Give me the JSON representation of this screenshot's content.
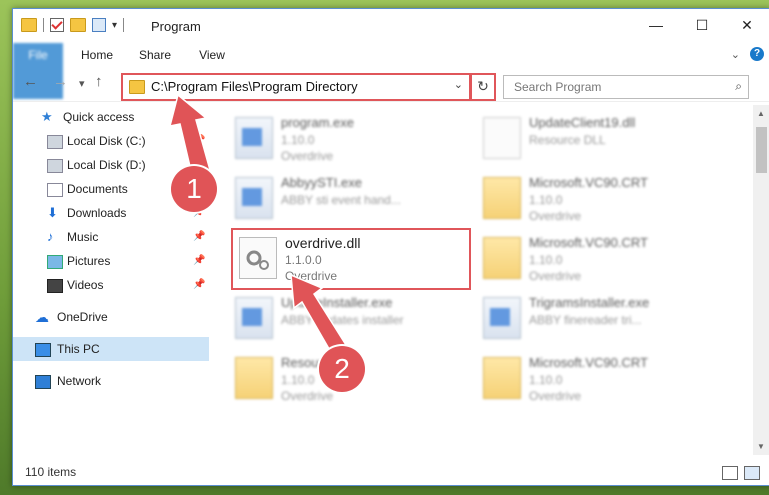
{
  "window": {
    "title": "Program",
    "controls": {
      "minimize": "—",
      "maximize": "☐",
      "close": "✕"
    }
  },
  "ribbon": {
    "tabs": [
      {
        "label": "File"
      },
      {
        "label": "Home"
      },
      {
        "label": "Share"
      },
      {
        "label": "View"
      }
    ]
  },
  "address": {
    "path": "C:\\Program Files\\Program Directory",
    "search_placeholder": "Search Program"
  },
  "sidebar": {
    "items": [
      {
        "label": "Quick access"
      },
      {
        "label": "Local Disk (C:)"
      },
      {
        "label": "Local Disk (D:)"
      },
      {
        "label": "Documents"
      },
      {
        "label": "Downloads"
      },
      {
        "label": "Music"
      },
      {
        "label": "Pictures"
      },
      {
        "label": "Videos"
      },
      {
        "label": "OneDrive"
      },
      {
        "label": "This PC"
      },
      {
        "label": "Network"
      }
    ]
  },
  "files": [
    {
      "name": "program.exe",
      "version": "1.10.0",
      "desc": "Overdrive",
      "icon": "exe-icon"
    },
    {
      "name": "UpdateClient19.dll",
      "version": "Resource DLL",
      "desc": "",
      "icon": "dll-icon"
    },
    {
      "name": "AbbyySTI.exe",
      "version": "ABBY sti event hand...",
      "desc": "",
      "icon": "exe-icon"
    },
    {
      "name": "Microsoft.VC90.CRT",
      "version": "1.10.0",
      "desc": "Overdrive",
      "icon": "folder-icon"
    },
    {
      "name": "overdrive.dll",
      "version": "1.1.0.0",
      "desc": "Overdrive",
      "icon": "dll-icon"
    },
    {
      "name": "Microsoft.VC90.CRT",
      "version": "1.10.0",
      "desc": "Overdrive",
      "icon": "folder-icon"
    },
    {
      "name": "UpdateInstaller.exe",
      "version": "ABBY updates installer",
      "desc": "",
      "icon": "exe-icon"
    },
    {
      "name": "TrigramsInstaller.exe",
      "version": "ABBY finereader tri...",
      "desc": "",
      "icon": "exe-icon"
    },
    {
      "name": "Resources",
      "version": "1.10.0",
      "desc": "Overdrive",
      "icon": "folder-icon"
    },
    {
      "name": "Microsoft.VC90.CRT",
      "version": "1.10.0",
      "desc": "Overdrive",
      "icon": "folder-icon"
    }
  ],
  "status": {
    "count": "110 items"
  },
  "annotations": {
    "step1": "1",
    "step2": "2"
  },
  "colors": {
    "accent": "#1979ca",
    "highlight": "#e0565a"
  }
}
